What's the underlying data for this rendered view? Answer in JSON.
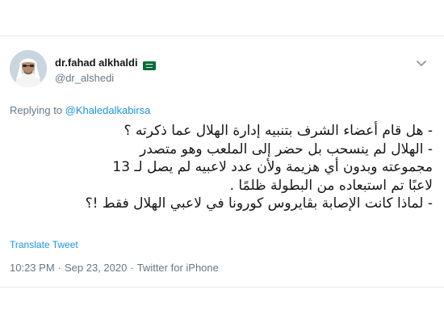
{
  "tweet": {
    "author": {
      "display_name": "dr.fahad alkhaldi",
      "handle": "@dr_alshedi",
      "flag_icon": "saudi-flag-icon"
    },
    "menu_icon": "chevron-down-icon",
    "reply": {
      "prefix": "Replying to",
      "mention": "@Khaledalkabirsa"
    },
    "text_lines": [
      "- هل قام أعضاء الشرف بتنبيه إدارة الهلال عما ذكرته ؟",
      "- الهلال لم ينسحب بل حضر إلى الملعب وهو متصدر",
      "مجموعته وبدون أي هزيمة ولأن عدد لاعبيه لم يصل لـ 13",
      "لاعبًا تم استبعاده من البطولة ظلمًا .",
      "- لماذا كانت الإصابة بڤايروس كورونا في لاعبي الهلال فقط !؟"
    ],
    "translate_label": "Translate Tweet",
    "time": "10:23 PM",
    "separator": "·",
    "date": "Sep 23, 2020",
    "source": "Twitter for iPhone"
  },
  "colors": {
    "link": "#1b95e0",
    "muted": "#657786",
    "text": "#14171a",
    "flag_green": "#006c35"
  }
}
